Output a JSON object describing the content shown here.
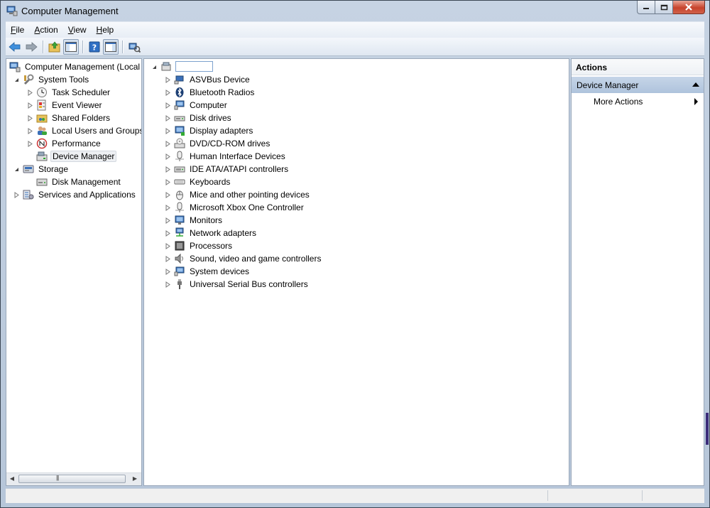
{
  "window": {
    "title": "Computer Management"
  },
  "menu": [
    {
      "label": "File",
      "accel": "F",
      "rest": "ile"
    },
    {
      "label": "Action",
      "accel": "A",
      "rest": "ction"
    },
    {
      "label": "View",
      "accel": "V",
      "rest": "iew"
    },
    {
      "label": "Help",
      "accel": "H",
      "rest": "elp"
    }
  ],
  "toolbar": {
    "buttons": [
      "back-arrow-icon",
      "forward-arrow-icon",
      "up-folder-icon",
      "show-hide-tree-icon",
      "help-icon",
      "show-hide-action-pane-icon",
      "properties-icon"
    ]
  },
  "nav_tree": {
    "root": "Computer Management (Local",
    "items": [
      {
        "label": "System Tools"
      },
      {
        "label": "Task Scheduler"
      },
      {
        "label": "Event Viewer"
      },
      {
        "label": "Shared Folders"
      },
      {
        "label": "Local Users and Groups"
      },
      {
        "label": "Performance"
      },
      {
        "label": "Device Manager"
      },
      {
        "label": "Storage"
      },
      {
        "label": "Disk Management"
      },
      {
        "label": "Services and Applications"
      }
    ],
    "scroll_grip": "|||"
  },
  "device_tree": {
    "computer_name": "",
    "categories": [
      "ASVBus Device",
      "Bluetooth Radios",
      "Computer",
      "Disk drives",
      "Display adapters",
      "DVD/CD-ROM drives",
      "Human Interface Devices",
      "IDE ATA/ATAPI controllers",
      "Keyboards",
      "Mice and other pointing devices",
      "Microsoft Xbox One Controller",
      "Monitors",
      "Network adapters",
      "Processors",
      "Sound, video and game controllers",
      "System devices",
      "Universal Serial Bus controllers"
    ]
  },
  "actions": {
    "header": "Actions",
    "group": "Device Manager",
    "more": "More Actions"
  },
  "colors": {
    "window_frame": "#b6c6d9",
    "actions_group": "#b9cbe2",
    "close_button": "#c7432c"
  }
}
